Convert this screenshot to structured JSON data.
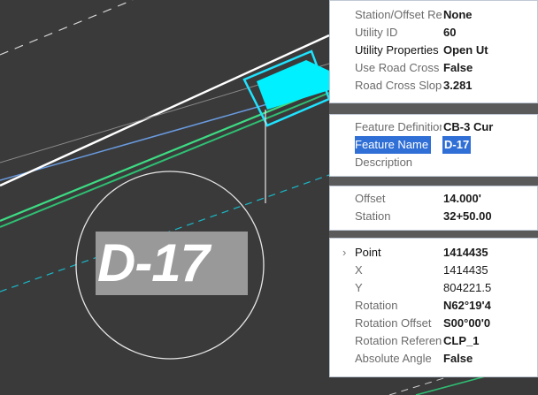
{
  "label_tag": "D-17",
  "groups": [
    {
      "rows": [
        {
          "label": "Station/Offset Ref",
          "value": "None"
        },
        {
          "label": "Utility ID",
          "value": "60"
        },
        {
          "label": "Utility Properties",
          "value": "Open Ut"
        },
        {
          "label": "Use Road Cross S",
          "value": "False"
        },
        {
          "label": "Road Cross Slope",
          "value": "3.281"
        }
      ]
    },
    {
      "rows": [
        {
          "label": "Feature Definition",
          "value": "CB-3 Cur"
        },
        {
          "label": "Feature Name",
          "value": "D-17"
        },
        {
          "label": "Description",
          "value": ""
        }
      ]
    },
    {
      "rows": [
        {
          "label": "Offset",
          "value": "14.000'"
        },
        {
          "label": "Station",
          "value": "32+50.00"
        }
      ]
    },
    {
      "rows": [
        {
          "label": "Point",
          "value": "1414435"
        },
        {
          "label": "X",
          "value": "1414435"
        },
        {
          "label": "Y",
          "value": "804221.5"
        },
        {
          "label": "Rotation",
          "value": "N62°19'4"
        },
        {
          "label": "Rotation Offset",
          "value": "S00°00'0"
        },
        {
          "label": "Rotation Referenc",
          "value": "CLP_1"
        },
        {
          "label": "Absolute Angle",
          "value": "False"
        }
      ]
    }
  ],
  "colors": {
    "canvas": "#3a3a3a",
    "selection": "#2f6fd6",
    "cyan": "#00e5ff",
    "green": "#3ddc84",
    "blue_line": "#6a9be0"
  }
}
